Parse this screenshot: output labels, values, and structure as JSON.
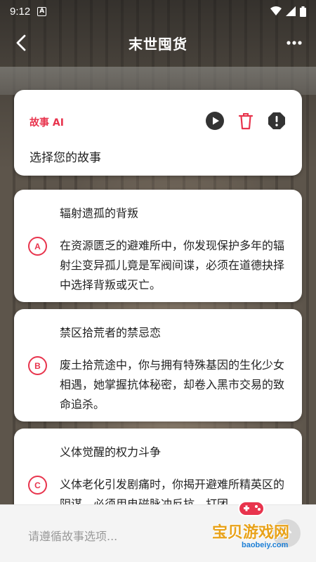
{
  "status_bar": {
    "time": "9:12",
    "notification_icon": "A"
  },
  "header": {
    "title": "末世囤货"
  },
  "intro": {
    "label": "故事 AI",
    "prompt": "选择您的故事"
  },
  "options": [
    {
      "badge": "A",
      "title": "辐射遗孤的背叛",
      "description": "在资源匮乏的避难所中，你发现保护多年的辐射尘变异孤儿竟是军阀间谍，必须在道德抉择中选择背叛或灭亡。"
    },
    {
      "badge": "B",
      "title": "禁区拾荒者的禁忌恋",
      "description": "废土拾荒途中，你与拥有特殊基因的生化少女相遇，她掌握抗体秘密，却卷入黑市交易的致命追杀。"
    },
    {
      "badge": "C",
      "title": "义体觉醒的权力斗争",
      "description": "义体老化引发剧痛时，你揭开避难所精英区的阴谋，必须用电磁脉冲反抗，打团"
    }
  ],
  "input": {
    "placeholder": "请遵循故事选项..."
  },
  "watermark": {
    "text": "宝贝游戏网",
    "url": "baobeiy.com"
  },
  "colors": {
    "accent": "#e8344d"
  }
}
